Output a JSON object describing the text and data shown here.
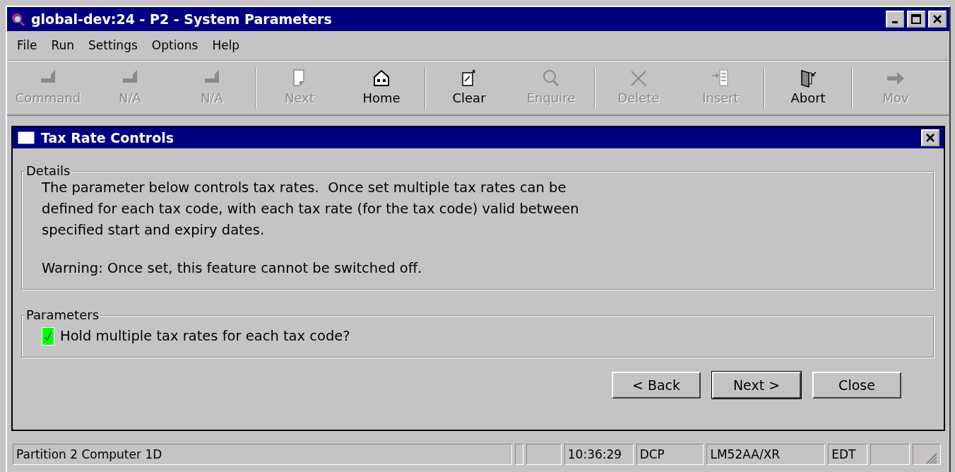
{
  "window": {
    "title": "global-dev:24 - P2 - System Parameters"
  },
  "menu": [
    "File",
    "Run",
    "Settings",
    "Options",
    "Help"
  ],
  "toolbar": [
    {
      "kind": "fkey",
      "label": "Command",
      "disabled": true
    },
    {
      "kind": "fkey",
      "label": "N/A",
      "disabled": true
    },
    {
      "kind": "fkey",
      "label": "N/A",
      "disabled": true
    },
    {
      "kind": "separator"
    },
    {
      "kind": "page",
      "label": "Next",
      "disabled": true
    },
    {
      "kind": "home",
      "label": "Home",
      "disabled": false
    },
    {
      "kind": "separator"
    },
    {
      "kind": "clear",
      "label": "Clear",
      "disabled": false
    },
    {
      "kind": "search",
      "label": "Enquire",
      "disabled": true
    },
    {
      "kind": "separator"
    },
    {
      "kind": "delete",
      "label": "Delete",
      "disabled": true
    },
    {
      "kind": "insert",
      "label": "Insert",
      "disabled": true
    },
    {
      "kind": "separator"
    },
    {
      "kind": "door",
      "label": "Abort",
      "disabled": false
    },
    {
      "kind": "separator"
    },
    {
      "kind": "arrow",
      "label": "Mov",
      "disabled": true
    }
  ],
  "dialog": {
    "title": "Tax Rate Controls",
    "details": {
      "legend": "Details",
      "text": "The parameter below controls tax rates.  Once set multiple tax rates can be\ndefined for each tax code, with each tax rate (for the tax code) valid between\nspecified start and expiry dates.",
      "warning": "Warning: Once set, this feature cannot be switched off."
    },
    "parameters": {
      "legend": "Parameters",
      "items": [
        {
          "label": "Hold multiple tax rates for each tax code?",
          "checked": true
        }
      ]
    },
    "buttons": [
      {
        "label": "< Back",
        "default": false
      },
      {
        "label": "Next >",
        "default": true
      },
      {
        "label": "Close",
        "default": false
      }
    ]
  },
  "status_bar": [
    {
      "kind": "text",
      "text": "Partition 2 Computer 1D"
    },
    {
      "kind": "blank"
    },
    {
      "kind": "blank"
    },
    {
      "kind": "text",
      "text": "10:36:29"
    },
    {
      "kind": "text",
      "text": "DCP"
    },
    {
      "kind": "text",
      "text": "LM52AA/XR"
    },
    {
      "kind": "text",
      "text": "EDT"
    },
    {
      "kind": "blank"
    },
    {
      "kind": "grip"
    }
  ]
}
